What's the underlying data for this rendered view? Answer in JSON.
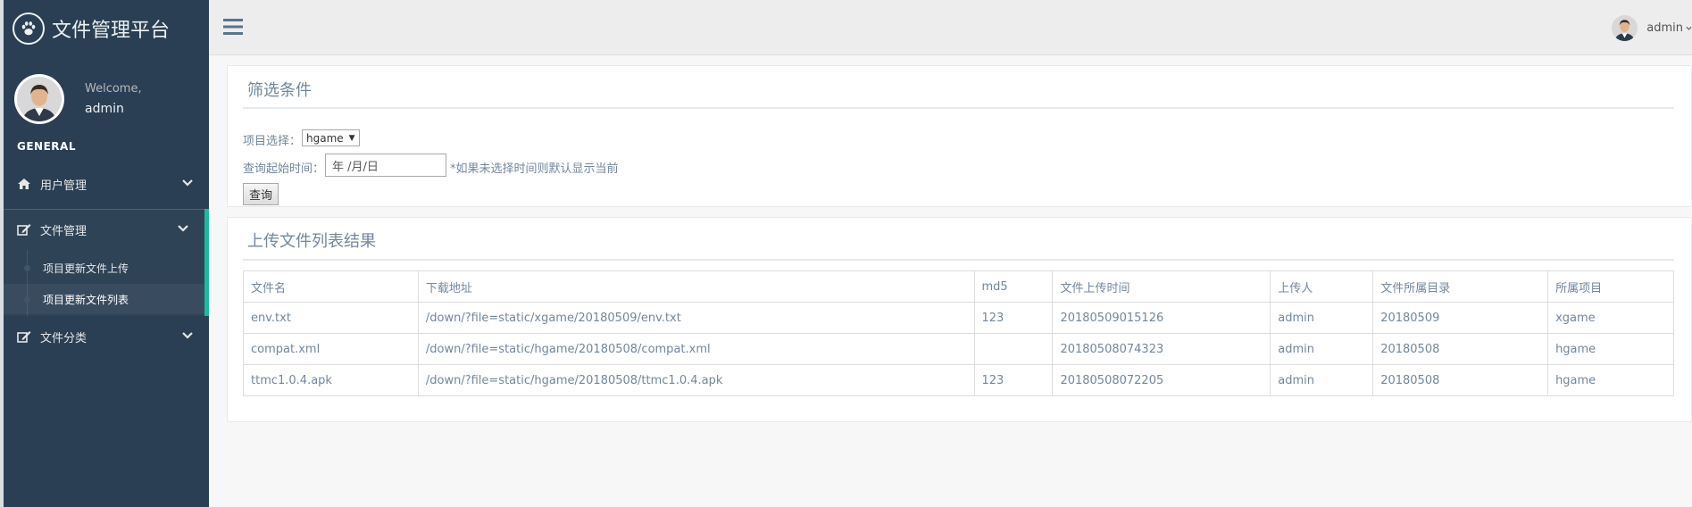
{
  "brand": {
    "title": "文件管理平台",
    "logo_icon": "paw-icon"
  },
  "profile": {
    "welcome": "Welcome,",
    "name": "admin"
  },
  "sidebar": {
    "section": "GENERAL",
    "items": [
      {
        "label": "用户管理",
        "icon": "home-icon"
      },
      {
        "label": "文件管理",
        "icon": "edit-icon",
        "children": [
          {
            "label": "项目更新文件上传"
          },
          {
            "label": "项目更新文件列表"
          }
        ]
      },
      {
        "label": "文件分类",
        "icon": "edit-icon"
      }
    ]
  },
  "topnav": {
    "user": "admin"
  },
  "filter": {
    "title": "筛选条件",
    "project_label": "项目选择：",
    "project_value": "hgame",
    "date_label": "查询起始时间：",
    "date_placeholder": "年 /月/日",
    "date_hint": "*如果未选择时间则默认显示当前",
    "query_button": "查询"
  },
  "results": {
    "title": "上传文件列表结果",
    "columns": [
      "文件名",
      "下载地址",
      "md5",
      "文件上传时间",
      "上传人",
      "文件所属目录",
      "所属项目"
    ],
    "rows": [
      [
        "env.txt",
        "/down/?file=static/xgame/20180509/env.txt",
        "123",
        "20180509015126",
        "admin",
        "20180509",
        "xgame"
      ],
      [
        "compat.xml",
        "/down/?file=static/hgame/20180508/compat.xml",
        "",
        "20180508074323",
        "admin",
        "20180508",
        "hgame"
      ],
      [
        "ttmc1.0.4.apk",
        "/down/?file=static/hgame/20180508/ttmc1.0.4.apk",
        "123",
        "20180508072205",
        "admin",
        "20180508",
        "hgame"
      ]
    ]
  },
  "colors": {
    "sidebar": "#2A3F54",
    "accent": "#1ABB9C",
    "text": "#73879C"
  }
}
